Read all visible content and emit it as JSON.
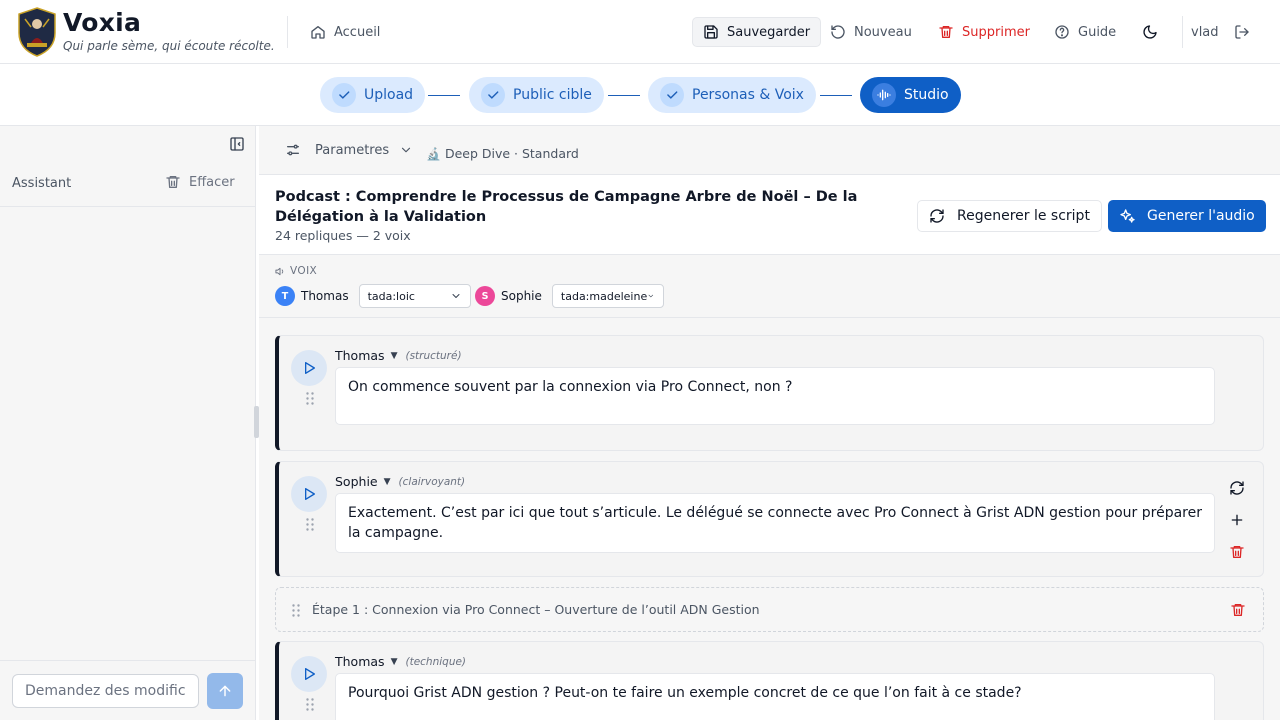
{
  "header": {
    "brand_title": "Voxia",
    "brand_subtitle": "Qui parle sème, qui écoute récolte.",
    "home_label": "Accueil",
    "save_label": "Sauvegarder",
    "new_label": "Nouveau",
    "delete_label": "Supprimer",
    "guide_label": "Guide",
    "username": "vlad"
  },
  "stepper": {
    "steps": [
      {
        "label": "Upload",
        "state": "done"
      },
      {
        "label": "Public cible",
        "state": "done"
      },
      {
        "label": "Personas & Voix",
        "state": "done"
      },
      {
        "label": "Studio",
        "state": "active"
      }
    ]
  },
  "sidebar": {
    "title": "Assistant",
    "clear_label": "Effacer",
    "input_placeholder": "Demandez des modifications..."
  },
  "main": {
    "params_label": "Parametres",
    "mode_label": "Deep Dive · Standard",
    "podcast_title": "Podcast : Comprendre le Processus de Campagne Arbre de Noël – De la Délégation à la Validation",
    "podcast_meta": "24 repliques — 2 voix",
    "regenerate_label": "Regenerer le script",
    "generate_audio_label": "Generer l'audio",
    "voices_label": "VOIX",
    "voices": [
      {
        "initial": "T",
        "name": "Thomas",
        "voice": "tada:loic",
        "color": "#3b82f6"
      },
      {
        "initial": "S",
        "name": "Sophie",
        "voice": "tada:madeleine",
        "color": "#ec4899"
      }
    ],
    "lines": [
      {
        "speaker": "Thomas",
        "tone": "(structuré)",
        "text": "On commence souvent par la connexion via Pro Connect, non ?"
      },
      {
        "speaker": "Sophie",
        "tone": "(clairvoyant)",
        "text": "Exactement. C’est par ici que tout s’articule. Le délégué se connecte avec Pro Connect à Grist ADN gestion pour préparer la campagne."
      },
      {
        "speaker": "Thomas",
        "tone": "(technique)",
        "text": "Pourquoi Grist ADN gestion ? Peut-on te faire un exemple concret de ce que l’on fait à ce stade?"
      }
    ],
    "section_title": "Étape 1 : Connexion via Pro Connect – Ouverture de l’outil ADN Gestion"
  },
  "colors": {
    "primary": "#0f5fc6",
    "step_done_bg": "#dbeafe",
    "danger": "#dc2626"
  }
}
